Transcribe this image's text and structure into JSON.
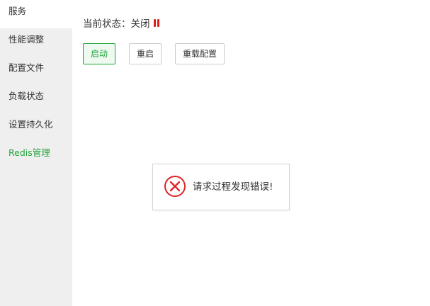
{
  "sidebar": {
    "items": [
      {
        "label": "服务"
      },
      {
        "label": "性能调整"
      },
      {
        "label": "配置文件"
      },
      {
        "label": "负载状态"
      },
      {
        "label": "设置持久化"
      },
      {
        "label": "Redis管理"
      }
    ],
    "active_index": 0,
    "accent_color": "#20a53a"
  },
  "status": {
    "label": "当前状态：",
    "value": "关闭",
    "indicator_icon": "pause-icon",
    "indicator_color": "#e01f1f"
  },
  "actions": {
    "start_label": "启动",
    "restart_label": "重启",
    "reload_config_label": "重载配置"
  },
  "toast": {
    "icon": "error-circle-x-icon",
    "icon_color": "#e0242b",
    "message": "请求过程发现错误!"
  }
}
